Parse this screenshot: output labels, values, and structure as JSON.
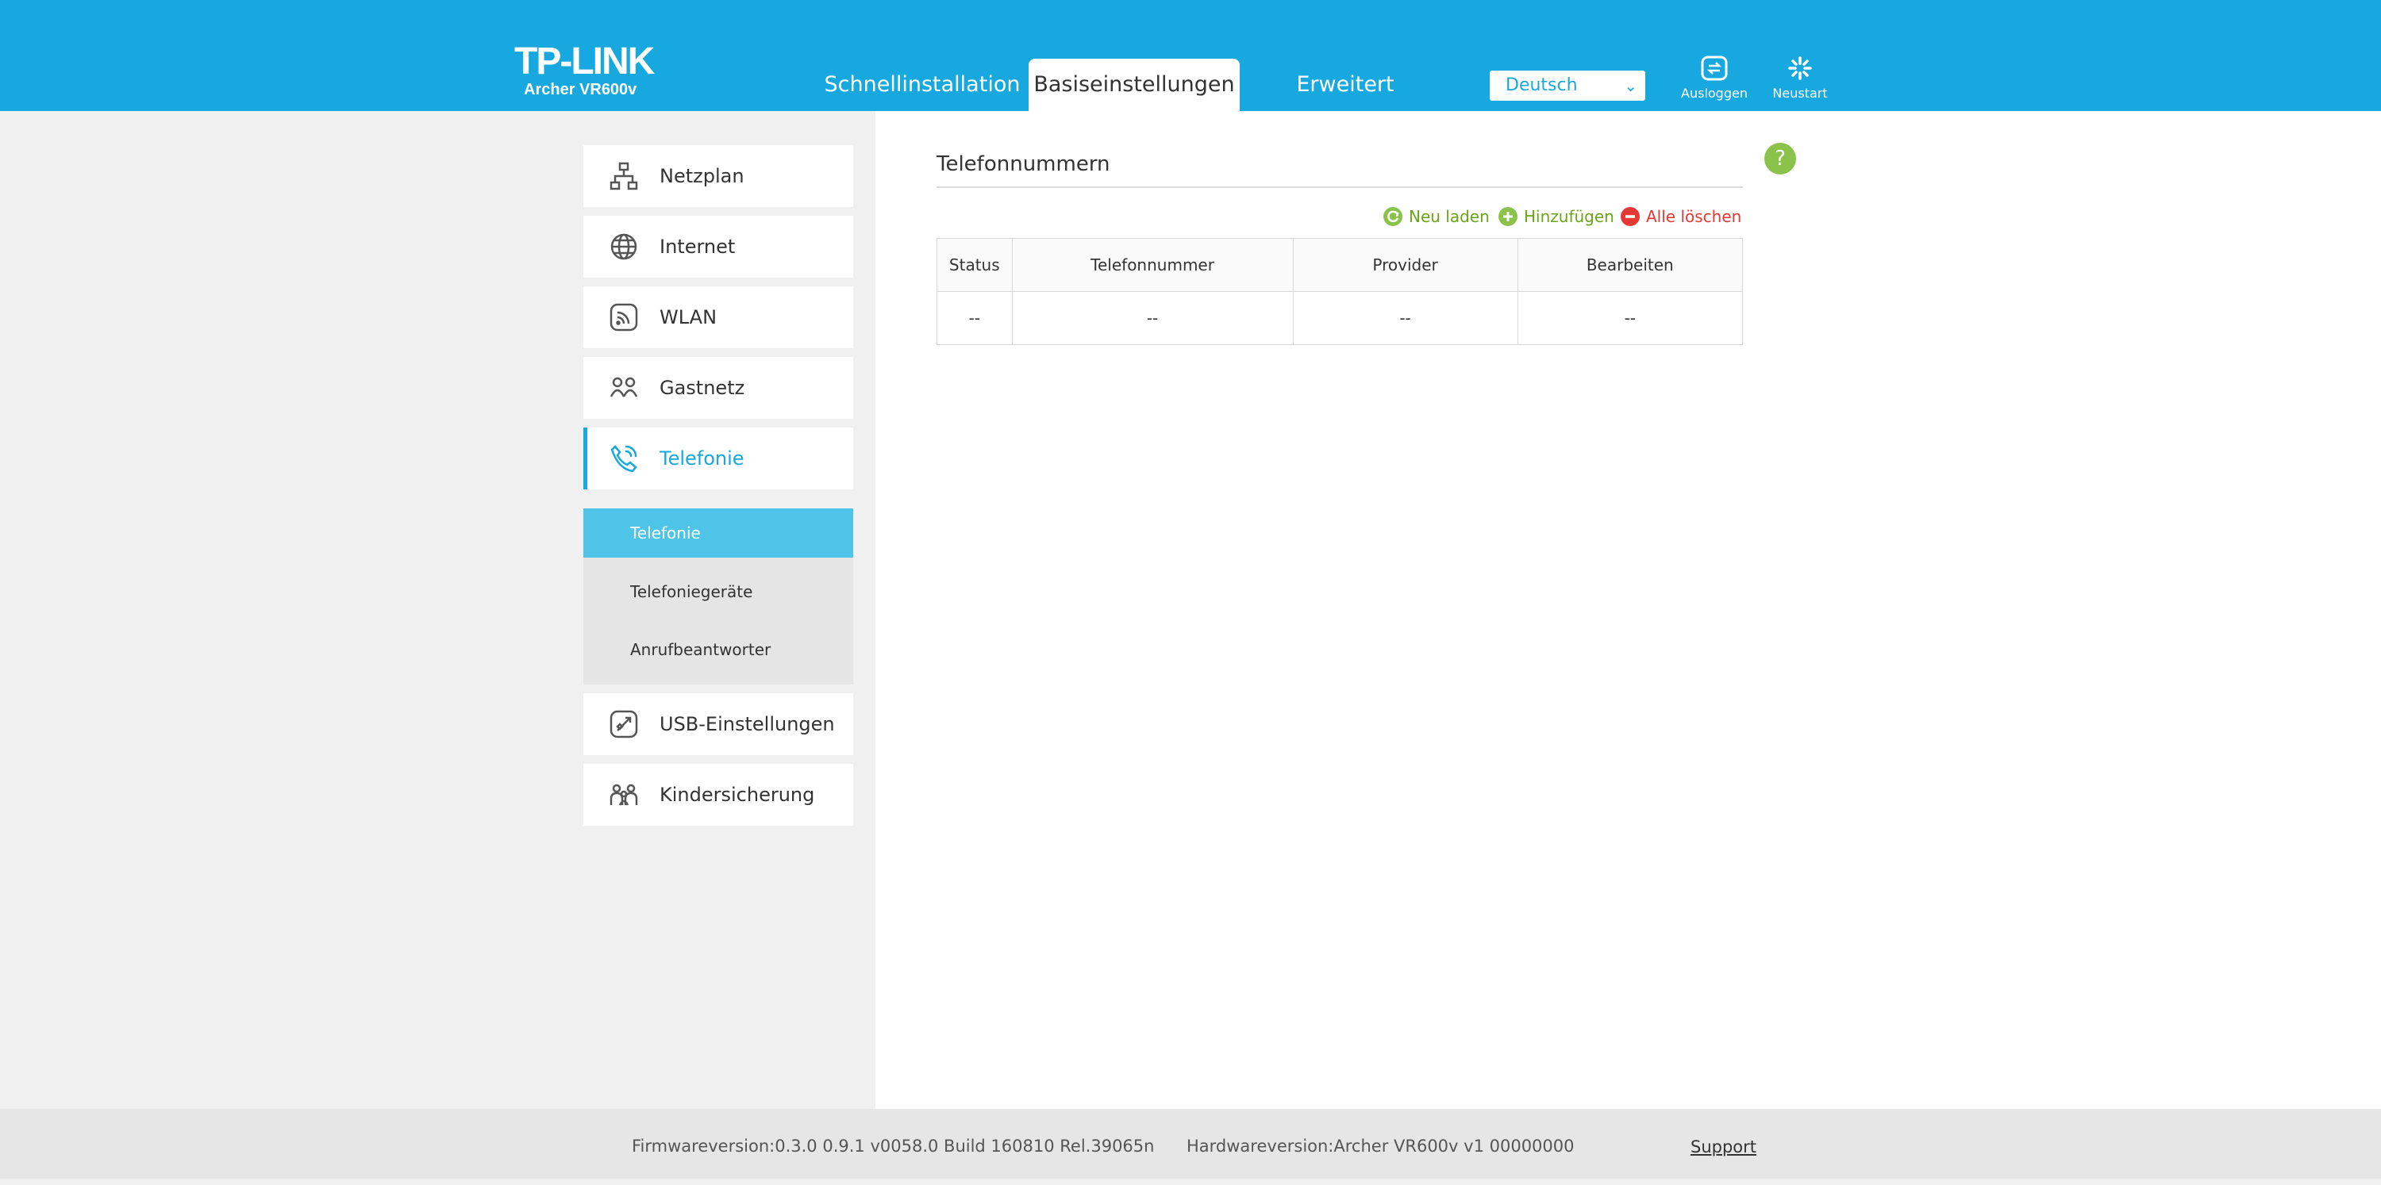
{
  "header": {
    "logo": "TP-LINK",
    "model": "Archer VR600v",
    "tabs": [
      {
        "label": "Schnellinstallation"
      },
      {
        "label": "Basiseinstellungen"
      },
      {
        "label": "Erweitert"
      }
    ],
    "language": "Deutsch",
    "logout_label": "Ausloggen",
    "reboot_label": "Neustart",
    "brand_color": "#16a8de"
  },
  "sidebar": {
    "items": [
      {
        "label": "Netzplan",
        "icon": "network-map-icon"
      },
      {
        "label": "Internet",
        "icon": "globe-icon"
      },
      {
        "label": "WLAN",
        "icon": "wifi-icon"
      },
      {
        "label": "Gastnetz",
        "icon": "guest-network-icon"
      },
      {
        "label": "Telefonie",
        "icon": "phone-icon"
      },
      {
        "label": "USB-Einstellungen",
        "icon": "usb-icon"
      },
      {
        "label": "Kindersicherung",
        "icon": "parental-control-icon"
      }
    ],
    "subitems": [
      {
        "label": "Telefonie"
      },
      {
        "label": "Telefoniegeräte"
      },
      {
        "label": "Anrufbeantworter"
      }
    ]
  },
  "main": {
    "title": "Telefonnummern",
    "help": "?",
    "actions": {
      "reload": "Neu laden",
      "add": "Hinzufügen",
      "delete_all": "Alle löschen"
    },
    "table": {
      "headers": [
        "Status",
        "Telefonnummer",
        "Provider",
        "Bearbeiten"
      ],
      "rows": [
        [
          "--",
          "--",
          "--",
          "--"
        ]
      ]
    }
  },
  "footer": {
    "firmware": "Firmwareversion:0.3.0 0.9.1 v0058.0 Build 160810 Rel.39065n",
    "hardware": "Hardwareversion:Archer VR600v v1 00000000",
    "support": "Support"
  }
}
